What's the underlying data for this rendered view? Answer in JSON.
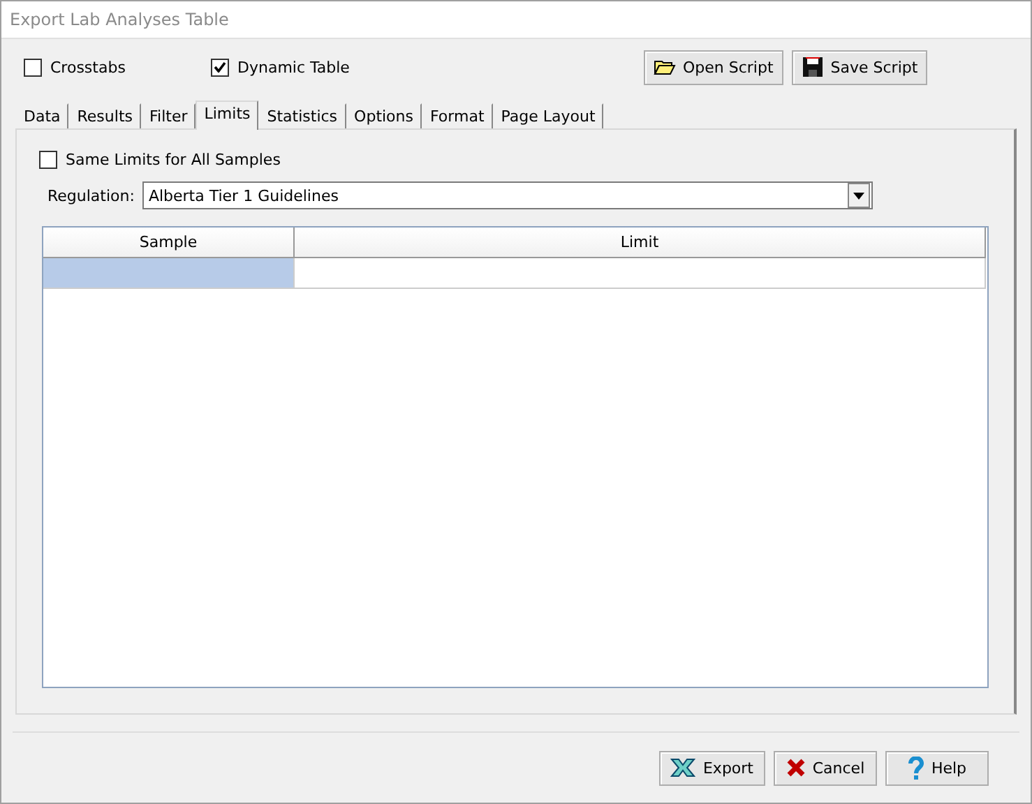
{
  "window": {
    "title": "Export Lab Analyses Table"
  },
  "options": [
    {
      "label": "Crosstabs",
      "checked": false
    },
    {
      "label": "Dynamic Table",
      "checked": true
    }
  ],
  "script_buttons": [
    {
      "kind": "open",
      "label": "Open Script"
    },
    {
      "kind": "save",
      "label": "Save Script"
    }
  ],
  "tabs": [
    {
      "label": "Data",
      "selected": false
    },
    {
      "label": "Results",
      "selected": false
    },
    {
      "label": "Filter",
      "selected": false
    },
    {
      "label": "Limits",
      "selected": true
    },
    {
      "label": "Statistics",
      "selected": false
    },
    {
      "label": "Options",
      "selected": false
    },
    {
      "label": "Format",
      "selected": false
    },
    {
      "label": "Page Layout",
      "selected": false
    }
  ],
  "same_limits": {
    "label": "Same Limits for All Samples",
    "checked": false
  },
  "regulation": {
    "label": "Regulation:",
    "value": "Alberta Tier 1 Guidelines"
  },
  "table": {
    "columns": [
      "Sample",
      "Limit"
    ],
    "rows": [
      {
        "sample_selected": true
      }
    ]
  },
  "buttons": [
    {
      "kind": "export",
      "label": "Export"
    },
    {
      "kind": "cancel",
      "label": "Cancel"
    },
    {
      "kind": "help",
      "label": "Help"
    }
  ]
}
